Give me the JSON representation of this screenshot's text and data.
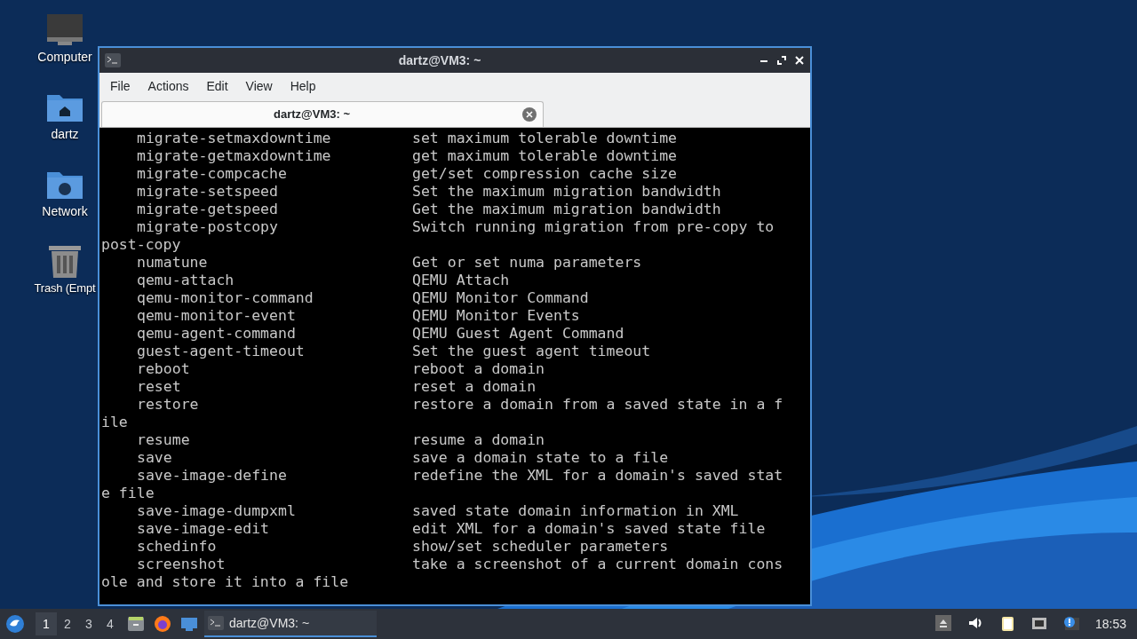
{
  "desktop_icons": [
    {
      "kind": "computer",
      "label": "Computer"
    },
    {
      "kind": "home",
      "label": "dartz"
    },
    {
      "kind": "network",
      "label": "Network"
    },
    {
      "kind": "trash",
      "label": "Trash (Empt"
    }
  ],
  "window": {
    "title": "dartz@VM3: ~",
    "menu": [
      "File",
      "Actions",
      "Edit",
      "View",
      "Help"
    ],
    "tabs": [
      {
        "label": "dartz@VM3: ~",
        "selected": true
      }
    ],
    "terminal_lines": [
      {
        "kind": "entry",
        "command": "migrate-setmaxdowntime",
        "description": "set maximum tolerable downtime"
      },
      {
        "kind": "entry",
        "command": "migrate-getmaxdowntime",
        "description": "get maximum tolerable downtime"
      },
      {
        "kind": "entry",
        "command": "migrate-compcache",
        "description": "get/set compression cache size"
      },
      {
        "kind": "entry",
        "command": "migrate-setspeed",
        "description": "Set the maximum migration bandwidth"
      },
      {
        "kind": "entry",
        "command": "migrate-getspeed",
        "description": "Get the maximum migration bandwidth"
      },
      {
        "kind": "entry",
        "command": "migrate-postcopy",
        "description": "Switch running migration from pre-copy to"
      },
      {
        "kind": "continuation",
        "text": "post-copy"
      },
      {
        "kind": "entry",
        "command": "numatune",
        "description": "Get or set numa parameters"
      },
      {
        "kind": "entry",
        "command": "qemu-attach",
        "description": "QEMU Attach"
      },
      {
        "kind": "entry",
        "command": "qemu-monitor-command",
        "description": "QEMU Monitor Command"
      },
      {
        "kind": "entry",
        "command": "qemu-monitor-event",
        "description": "QEMU Monitor Events"
      },
      {
        "kind": "entry",
        "command": "qemu-agent-command",
        "description": "QEMU Guest Agent Command"
      },
      {
        "kind": "entry",
        "command": "guest-agent-timeout",
        "description": "Set the guest agent timeout"
      },
      {
        "kind": "entry",
        "command": "reboot",
        "description": "reboot a domain"
      },
      {
        "kind": "entry",
        "command": "reset",
        "description": "reset a domain"
      },
      {
        "kind": "entry",
        "command": "restore",
        "description": "restore a domain from a saved state in a f"
      },
      {
        "kind": "continuation",
        "text": "ile"
      },
      {
        "kind": "entry",
        "command": "resume",
        "description": "resume a domain"
      },
      {
        "kind": "entry",
        "command": "save",
        "description": "save a domain state to a file"
      },
      {
        "kind": "entry",
        "command": "save-image-define",
        "description": "redefine the XML for a domain's saved stat"
      },
      {
        "kind": "continuation",
        "text": "e file"
      },
      {
        "kind": "entry",
        "command": "save-image-dumpxml",
        "description": "saved state domain information in XML"
      },
      {
        "kind": "entry",
        "command": "save-image-edit",
        "description": "edit XML for a domain's saved state file"
      },
      {
        "kind": "entry",
        "command": "schedinfo",
        "description": "show/set scheduler parameters"
      },
      {
        "kind": "entry",
        "command": "screenshot",
        "description": "take a screenshot of a current domain cons"
      },
      {
        "kind": "continuation",
        "text": "ole and store it into a file"
      }
    ]
  },
  "taskbar": {
    "workspaces": [
      {
        "label": "1",
        "selected": true
      },
      {
        "label": "2",
        "selected": false
      },
      {
        "label": "3",
        "selected": false
      },
      {
        "label": "4",
        "selected": false
      }
    ],
    "launchers": [
      {
        "kind": "files"
      },
      {
        "kind": "browser"
      },
      {
        "kind": "desktop"
      }
    ],
    "tasks": [
      {
        "label": "dartz@VM3: ~",
        "selected": true
      }
    ],
    "tray": [
      {
        "kind": "eject"
      },
      {
        "kind": "volume"
      },
      {
        "kind": "clipboard"
      },
      {
        "kind": "network"
      },
      {
        "kind": "notification"
      }
    ],
    "clock": "18:53"
  }
}
